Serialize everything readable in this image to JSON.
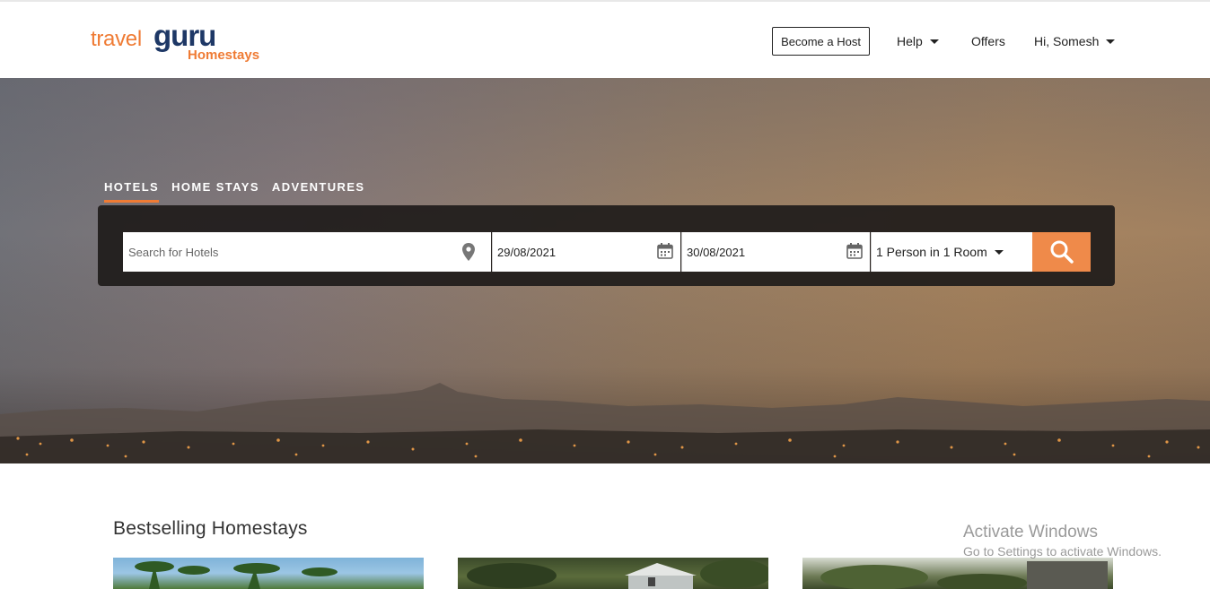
{
  "header": {
    "logo": {
      "travel": "travel",
      "guru": "guru",
      "homestays": "Homestays"
    },
    "become_host": "Become a Host",
    "help": "Help",
    "offers": "Offers",
    "user": "Hi, Somesh"
  },
  "search": {
    "tabs": [
      {
        "label": "HOTELS",
        "active": true
      },
      {
        "label": "HOME STAYS",
        "active": false
      },
      {
        "label": "ADVENTURES",
        "active": false
      }
    ],
    "hotel_placeholder": "Search for Hotels",
    "checkin": "29/08/2021",
    "checkout": "30/08/2021",
    "guests": "1 Person in 1 Room"
  },
  "bestselling": {
    "title": "Bestselling Homestays"
  },
  "watermark": {
    "title": "Activate Windows",
    "subtitle": "Go to Settings to activate Windows."
  },
  "colors": {
    "accent": "#ef7b34",
    "brand_navy": "#1e3866",
    "search_button": "#ef8a4a"
  }
}
